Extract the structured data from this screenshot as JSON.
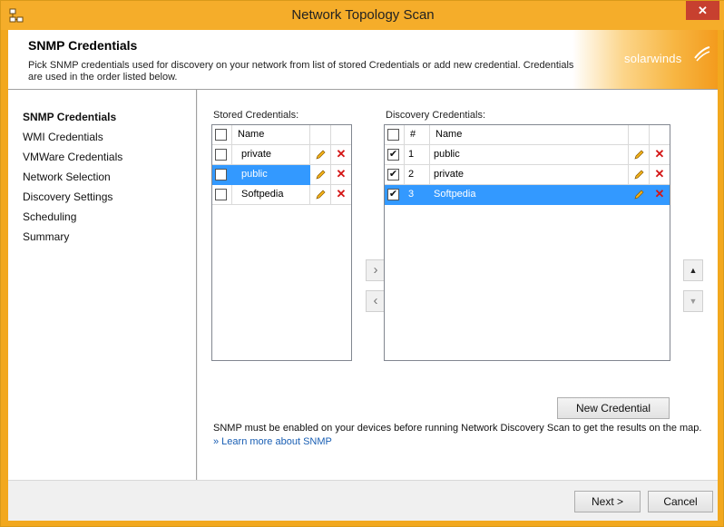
{
  "window": {
    "title": "Network Topology Scan",
    "close_label": "✕"
  },
  "header": {
    "title": "SNMP Credentials",
    "description": "Pick SNMP credentials used for discovery on your network from list of stored Credentials or add new credential. Credentials are used in the order listed below.",
    "logo_text": "solarwinds"
  },
  "sidebar": {
    "items": [
      {
        "label": "SNMP Credentials",
        "active": true
      },
      {
        "label": "WMI Credentials",
        "active": false
      },
      {
        "label": "VMWare Credentials",
        "active": false
      },
      {
        "label": "Network Selection",
        "active": false
      },
      {
        "label": "Discovery Settings",
        "active": false
      },
      {
        "label": "Scheduling",
        "active": false
      },
      {
        "label": "Summary",
        "active": false
      }
    ]
  },
  "stored": {
    "label": "Stored Credentials:",
    "column_name": "Name",
    "rows": [
      {
        "name": "private",
        "checked": false,
        "selected": false
      },
      {
        "name": "public",
        "checked": false,
        "selected": true
      },
      {
        "name": "Softpedia",
        "checked": false,
        "selected": false
      }
    ]
  },
  "discovery": {
    "label": "Discovery Credentials:",
    "column_num": "#",
    "column_name": "Name",
    "rows": [
      {
        "num": "1",
        "name": "public",
        "checked": true,
        "selected": false
      },
      {
        "num": "2",
        "name": "private",
        "checked": true,
        "selected": false
      },
      {
        "num": "3",
        "name": "Softpedia",
        "checked": true,
        "selected": true
      }
    ]
  },
  "transfer": {
    "add_glyph": "›",
    "remove_glyph": "‹"
  },
  "order": {
    "up_glyph": "▲",
    "down_glyph": "▼"
  },
  "new_credential_label": "New Credential",
  "note": "SNMP must be enabled on your devices before running Network Discovery Scan to get the results on the map.",
  "learn_more": "» Learn more about SNMP",
  "footer": {
    "next_label": "Next >",
    "cancel_label": "Cancel"
  },
  "colors": {
    "accent": "#f5ad2a",
    "selection": "#3399ff",
    "close": "#c7402f",
    "link": "#1a5fb4",
    "delete": "#d41515"
  },
  "icons": {
    "pencil": "pencil-icon",
    "delete": "delete-icon",
    "app": "network-icon",
    "logo": "solarwinds-logo-icon"
  }
}
